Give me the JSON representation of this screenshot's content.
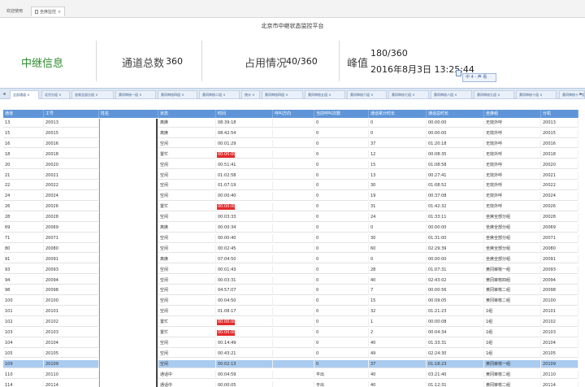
{
  "top_tabs": [
    {
      "label": "欢迎使用",
      "closable": false
    },
    {
      "label": "坐席监控",
      "closable": true
    }
  ],
  "page_title": "北京市中继状态监控平台",
  "summary": {
    "relay_label": "中继信息",
    "total_label": "通道总数",
    "total_value": "360",
    "usage_label": "占用情况",
    "usage_value": "40/360",
    "peak_label": "峰值",
    "peak_value": "180/360",
    "peak_time": "2016年8月3日 13:25:44"
  },
  "colors": {
    "accent": "#5f95d8",
    "busy": "#e52a2a",
    "selected_row": "#a9cbef",
    "relay_label": "#2e8b2e"
  },
  "sub_tabs": [
    "全部通道",
    "北京分组",
    "坐席全部分组",
    "黄冈审核一组",
    "黄冈审核四组",
    "黄冈审核二组",
    "统计",
    "黄冈审核四组",
    "黄冈审核五组",
    "黄冈审核六组",
    "黄冈审核七组",
    "黄冈审核八组",
    "黄冈审核九组",
    "黄冈审核十组",
    "黄冈审核十一组"
  ],
  "columns": [
    "通道",
    "工号",
    "姓名",
    "状态",
    "时间",
    "呼叫方向",
    "当前呼叫次数",
    "通话累计时长",
    "通话总时长",
    "坐席组",
    "分机"
  ],
  "rows": [
    [
      "13",
      "20013",
      "",
      "离席",
      "08:39:18",
      "",
      "0",
      "0",
      "00:00:00",
      "无效外呼",
      "20013"
    ],
    [
      "15",
      "20015",
      "",
      "离席",
      "08:42:54",
      "",
      "0",
      "0",
      "00:00:00",
      "无效外呼",
      "20015"
    ],
    [
      "16",
      "20016",
      "",
      "空闲",
      "00:01:29",
      "",
      "0",
      "37",
      "01:20:18",
      "无效外呼",
      "20016"
    ],
    [
      "18",
      "20018",
      "",
      "置忙",
      "00:00:00",
      "",
      "0",
      "12",
      "00:08:35",
      "无效外呼",
      "20018"
    ],
    [
      "20",
      "20020",
      "",
      "空闲",
      "00:51:41",
      "",
      "0",
      "15",
      "01:08:58",
      "无效外呼",
      "20020"
    ],
    [
      "21",
      "20021",
      "",
      "空闲",
      "01:02:58",
      "",
      "0",
      "13",
      "00:27:41",
      "无效外呼",
      "20021"
    ],
    [
      "22",
      "20022",
      "",
      "空闲",
      "01:07:19",
      "",
      "0",
      "30",
      "01:08:52",
      "无效外呼",
      "20022"
    ],
    [
      "24",
      "20024",
      "",
      "空闲",
      "00:00:40",
      "",
      "0",
      "19",
      "00:37:08",
      "无效外呼",
      "20024"
    ],
    [
      "26",
      "20026",
      "",
      "置忙",
      "00:00:00",
      "",
      "0",
      "31",
      "01:42:32",
      "无效外呼",
      "20026"
    ],
    [
      "28",
      "20028",
      "",
      "空闲",
      "00:03:33",
      "",
      "0",
      "24",
      "01:33:11",
      "坐席全部分组",
      "20028"
    ],
    [
      "69",
      "20069",
      "",
      "离席",
      "00:00:34",
      "",
      "0",
      "0",
      "00:00:00",
      "坐席全部分组",
      "20069"
    ],
    [
      "71",
      "20071",
      "",
      "空闲",
      "00:00:40",
      "",
      "0",
      "30",
      "01:31:00",
      "坐席全部分组",
      "20071"
    ],
    [
      "80",
      "20080",
      "",
      "空闲",
      "00:02:45",
      "",
      "0",
      "60",
      "02:29:39",
      "坐席全部分组",
      "20080"
    ],
    [
      "91",
      "20091",
      "",
      "离席",
      "07:04:50",
      "",
      "0",
      "0",
      "00:00:00",
      "坐席全部分组",
      "20091"
    ],
    [
      "93",
      "20093",
      "",
      "空闲",
      "00:01:43",
      "",
      "0",
      "28",
      "01:07:31",
      "黄冈审核一组",
      "20093"
    ],
    [
      "94",
      "20094",
      "",
      "空闲",
      "00:03:31",
      "",
      "0",
      "40",
      "02:43:02",
      "黄冈审核四组",
      "20094"
    ],
    [
      "98",
      "20098",
      "",
      "空闲",
      "04:57:07",
      "",
      "0",
      "7",
      "00:00:56",
      "黄冈审核二组",
      "20098"
    ],
    [
      "100",
      "20100",
      "",
      "空闲",
      "00:04:50",
      "",
      "0",
      "15",
      "00:09:05",
      "黄冈审核二组",
      "20100"
    ],
    [
      "101",
      "20101",
      "",
      "空闲",
      "01:08:17",
      "",
      "0",
      "32",
      "01:21:23",
      "1组",
      "20101"
    ],
    [
      "102",
      "20102",
      "",
      "置忙",
      "00:00:00",
      "",
      "0",
      "1",
      "00:00:08",
      "1组",
      "20102"
    ],
    [
      "103",
      "20103",
      "",
      "置忙",
      "00:00:00",
      "",
      "0",
      "2",
      "00:04:34",
      "1组",
      "20103"
    ],
    [
      "104",
      "20104",
      "",
      "空闲",
      "00:14:49",
      "",
      "0",
      "40",
      "01:33:31",
      "1组",
      "20104"
    ],
    [
      "105",
      "20105",
      "",
      "空闲",
      "00:43:21",
      "",
      "0",
      "49",
      "02:24:30",
      "1组",
      "20105"
    ],
    [
      "109",
      "20109",
      "",
      "空闲",
      "00:02:13",
      "",
      "0",
      "37",
      "01:18:23",
      "黄冈审核一组",
      "20109"
    ],
    [
      "110",
      "20110",
      "",
      "通话中",
      "00:04:59",
      "",
      "平出",
      "40",
      "03:21:40",
      "黄冈审核二组",
      "20110"
    ],
    [
      "114",
      "20114",
      "",
      "通话中",
      "00:00:05",
      "",
      "平出",
      "40",
      "01:12:31",
      "黄冈审核二组",
      "20114"
    ]
  ],
  "selected_row_index": 23,
  "calendar_tooltip": "中 4 - 声 看"
}
